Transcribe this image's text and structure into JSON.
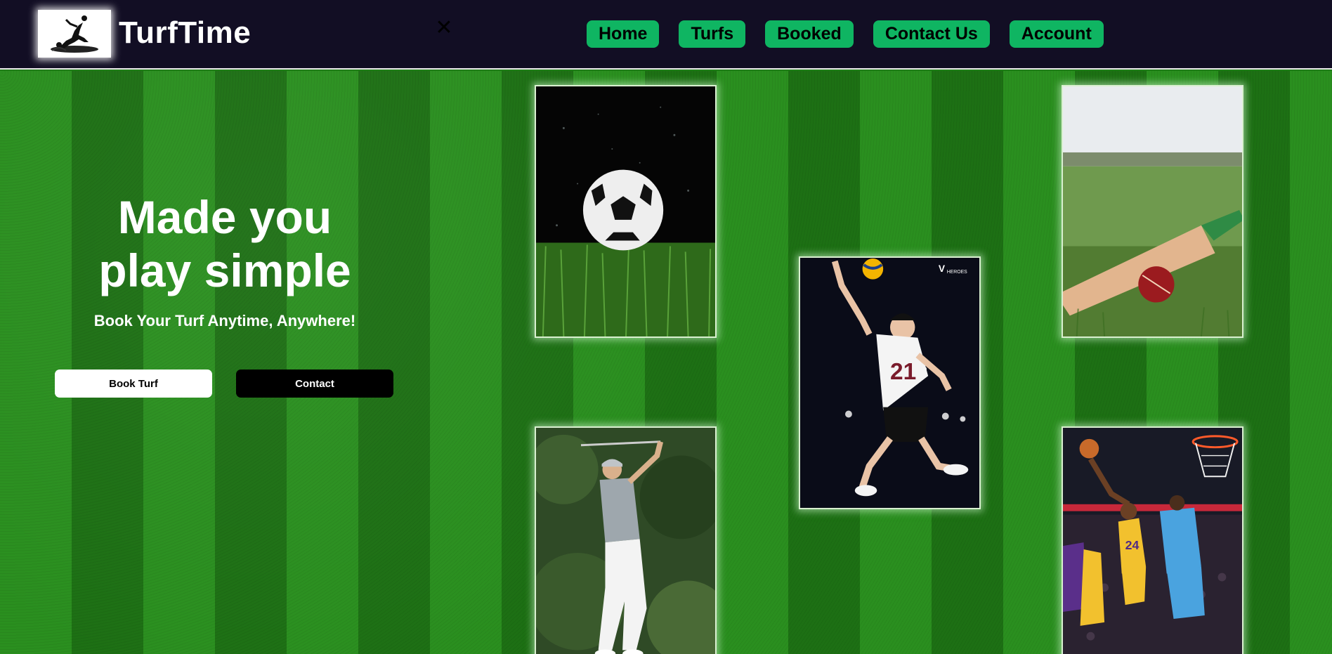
{
  "brand": {
    "name": "TurfTime",
    "logo_icon": "footballer-kick-logo"
  },
  "navbar": {
    "close_icon": "close-icon",
    "links": [
      "Home",
      "Turfs",
      "Booked",
      "Contact Us",
      "Account"
    ]
  },
  "hero": {
    "headline_line1": "Made you",
    "headline_line2": "play simple",
    "subheadline": "Book Your Turf Anytime, Anywhere!",
    "book_button": "Book Turf",
    "contact_button": "Contact"
  },
  "gallery": [
    {
      "name": "soccer-ball-photo"
    },
    {
      "name": "volleyball-player-photo",
      "badge_text": "HEROES"
    },
    {
      "name": "cricket-bat-ball-photo"
    },
    {
      "name": "golfer-photo"
    },
    {
      "name": "basketball-dunk-photo"
    }
  ],
  "colors": {
    "navbar_bg": "#120e24",
    "nav_button": "#0fb562",
    "turf_light": "#2a8f1f",
    "turf_dark": "#1d7014"
  }
}
